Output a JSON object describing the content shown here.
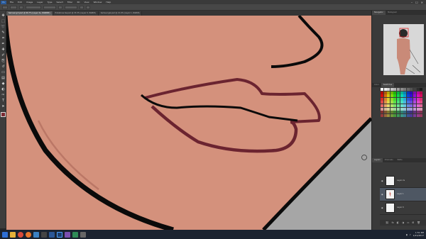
{
  "menubar": {
    "app_logo": "Ps",
    "items": [
      "File",
      "Edit",
      "Image",
      "Layer",
      "Type",
      "Select",
      "Filter",
      "3D",
      "View",
      "Window",
      "Help"
    ],
    "window_controls": [
      "–",
      "☐",
      "✕"
    ]
  },
  "tabs": [
    {
      "label": "Samuel girl.psd @ 66.7% (Layer 2s, RGB/8#)",
      "active": true
    },
    {
      "label": "Pinkstone bw.psd @ 33.3% (Layer 0, RGB/8)",
      "active": false
    },
    {
      "label": "Samuel gal.psd @ 21.9% (Layer 1, RGB/8)",
      "active": false
    }
  ],
  "tools": [
    "move-tool",
    "marquee-tool",
    "lasso-tool",
    "quick-select-tool",
    "crop-tool",
    "eyedropper-tool",
    "healing-tool",
    "brush-tool",
    "clone-tool",
    "history-brush-tool",
    "eraser-tool",
    "gradient-tool",
    "blur-tool",
    "dodge-tool",
    "pen-tool",
    "type-tool",
    "path-select-tool",
    "shape-tool",
    "hand-tool",
    "zoom-tool"
  ],
  "right_panel": {
    "navigator_tabs": [
      "Navigator",
      "Histogram"
    ],
    "swatches_tabs": [
      "Color",
      "Swatches"
    ],
    "layers_tabs": [
      "Layers",
      "Channels",
      "Paths"
    ],
    "layers": [
      {
        "name": "Layer 2s",
        "selected": false
      },
      {
        "name": "Layer 1",
        "selected": true
      },
      {
        "name": "Layer 0",
        "selected": false
      }
    ]
  },
  "canvas": {
    "skin_color": "#d4917c",
    "background_color": "#a6a6a6",
    "lip_color": "#6b2430",
    "outline_color": "#0a0a0a"
  },
  "taskbar": {
    "apps": [
      "start-icon",
      "explorer-icon",
      "chrome-icon",
      "firefox-icon",
      "store-icon",
      "terminal-icon",
      "word-icon",
      "photoshop-icon",
      "media-icon",
      "game-icon",
      "settings-icon"
    ],
    "clock_time": "1:51 PM",
    "clock_date": "1/21/2017"
  }
}
